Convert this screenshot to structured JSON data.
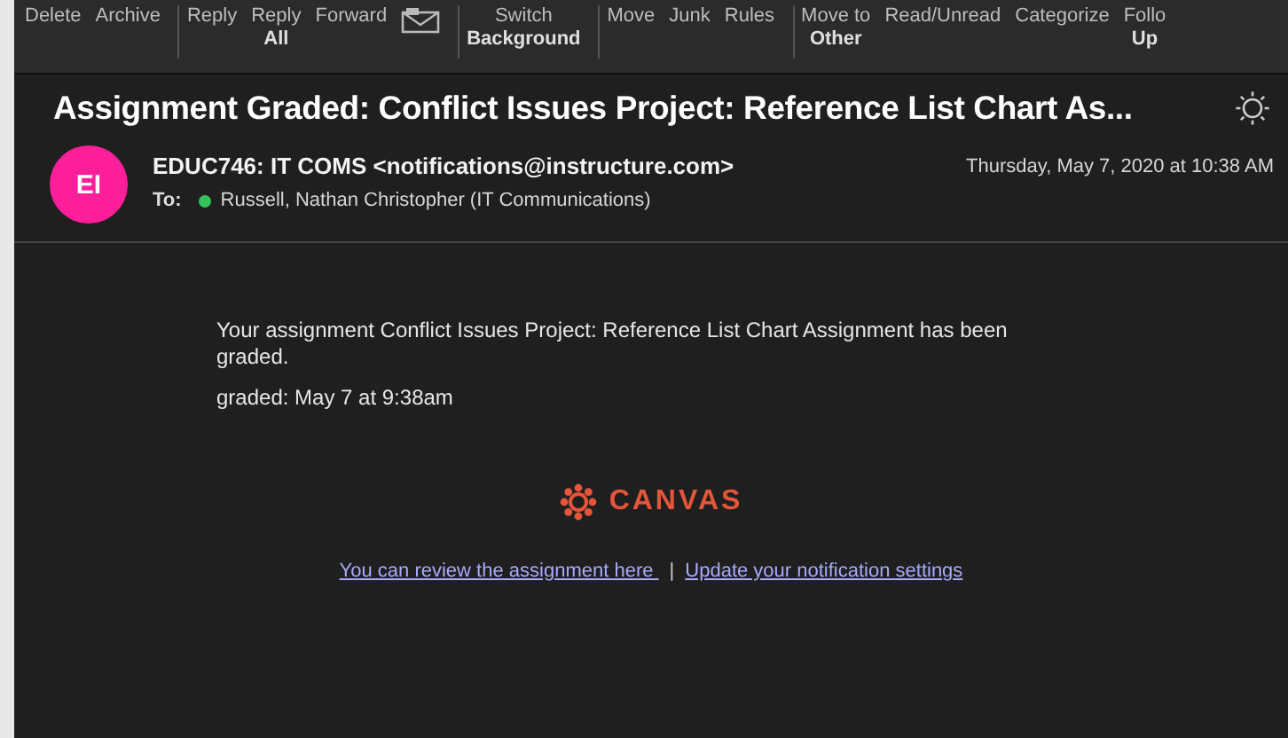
{
  "toolbar": {
    "groups": [
      {
        "items": [
          {
            "kind": "text",
            "label": "Delete"
          },
          {
            "kind": "text",
            "label": "Archive"
          }
        ]
      },
      {
        "items": [
          {
            "kind": "text",
            "label": "Reply"
          },
          {
            "kind": "text",
            "label": "Reply",
            "sublabel": "All"
          },
          {
            "kind": "text",
            "label": "Forward"
          },
          {
            "kind": "icon"
          }
        ]
      },
      {
        "items": [
          {
            "kind": "text",
            "label": "Switch",
            "sublabel": "Background"
          }
        ]
      },
      {
        "items": [
          {
            "kind": "text",
            "label": "Move"
          },
          {
            "kind": "text",
            "label": "Junk"
          },
          {
            "kind": "text",
            "label": "Rules"
          }
        ]
      },
      {
        "items": [
          {
            "kind": "text",
            "label": "Move to",
            "sublabel": "Other"
          },
          {
            "kind": "text",
            "label": "Read/Unread"
          },
          {
            "kind": "text",
            "label": "Categorize"
          },
          {
            "kind": "text",
            "label": "Follo",
            "sublabel": "Up"
          }
        ]
      }
    ]
  },
  "message": {
    "subject": "Assignment Graded: Conflict Issues Project: Reference List Chart As...",
    "avatar": {
      "initials": "EI",
      "color": "#ff1f9a"
    },
    "sender": "EDUC746: IT COMS <notifications@instructure.com>",
    "date": "Thursday, May 7, 2020 at 10:38 AM",
    "to_label": "To:",
    "recipient": {
      "name": "Russell, Nathan Christopher (IT Communications)",
      "color": "#35c25a"
    }
  },
  "body": {
    "paragraphs": [
      "Your assignment Conflict Issues Project: Reference List Chart Assignment has been graded.",
      "graded: May 7 at 9:38am"
    ],
    "logo_text": "CANVAS",
    "links": [
      "You can review the assignment here ",
      "Update your notification settings"
    ],
    "separator": "|"
  }
}
